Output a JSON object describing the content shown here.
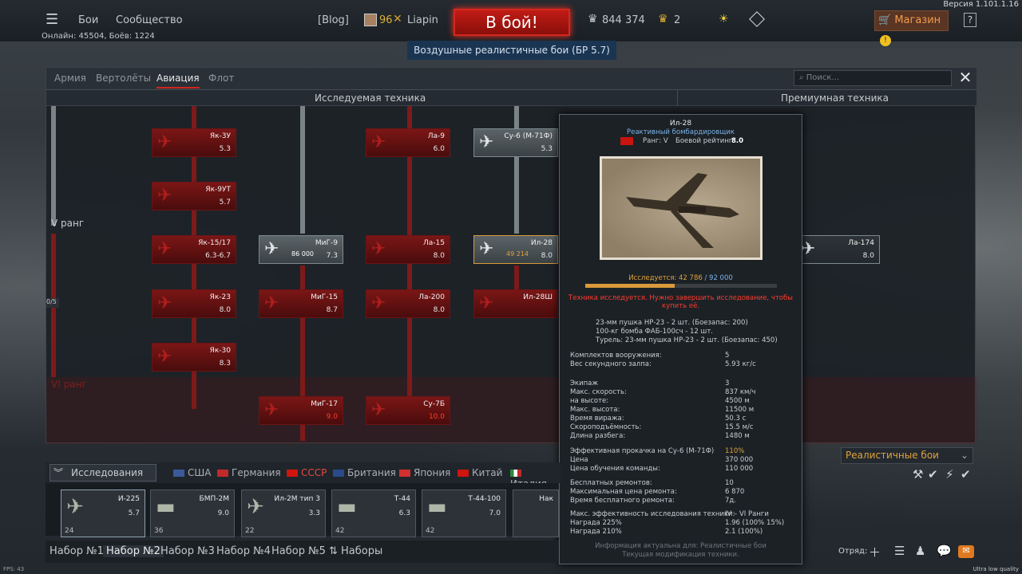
{
  "topbar": {
    "battles": "Бои",
    "community": "Сообщество",
    "blog": "[Blog]",
    "player_level": "96",
    "player_name": "Liapin",
    "battle_button": "В бой!",
    "silver_lions": "844 374",
    "golden_eagles": "2",
    "shop": "Магазин",
    "help": "?",
    "version": "Версия 1.101.1.16",
    "online": "Онлайн: 45504, Боёв: 1224",
    "mode_banner": "Воздушные реалистичные бои (БР 5.7)"
  },
  "window": {
    "tabs": [
      "Армия",
      "Вертолёты",
      "Авиация",
      "Флот"
    ],
    "active_tab": "Авиация",
    "search_placeholder": "Поиск...",
    "col_research": "Исследуемая техника",
    "col_premium": "Премиумная техника",
    "rank5": "V ранг",
    "rank6": "VI ранг",
    "progress_counter": "0/5"
  },
  "tree": {
    "yak3u": {
      "name": "Як-3У",
      "br": "5.3"
    },
    "yak9ut": {
      "name": "Як-9УТ",
      "br": "5.7"
    },
    "yak15": {
      "name": "Як-15/17",
      "br": "6.3-6.7"
    },
    "yak23": {
      "name": "Як-23",
      "br": "8.0"
    },
    "yak30": {
      "name": "Як-30",
      "br": "8.3"
    },
    "mig9": {
      "name": "МиГ-9",
      "br": "7.3",
      "cost": "86 000"
    },
    "mig15": {
      "name": "МиГ-15",
      "br": "8.7"
    },
    "mig17": {
      "name": "МиГ-17",
      "br": "9.0"
    },
    "la9": {
      "name": "Ла-9",
      "br": "6.0"
    },
    "la15": {
      "name": "Ла-15",
      "br": "8.0"
    },
    "la200": {
      "name": "Ла-200",
      "br": "8.0"
    },
    "su7b": {
      "name": "Су-7Б",
      "br": "10.0"
    },
    "su6": {
      "name": "Су-6 (М-71Ф)",
      "br": "5.3"
    },
    "il28": {
      "name": "Ил-28",
      "br": "8.0",
      "cost": "49 214"
    },
    "il28sh": {
      "name": "Ил-28Ш",
      "br": ""
    },
    "la174": {
      "name": "Ла-174",
      "br": "8.0"
    }
  },
  "tooltip": {
    "name": "Ил-28",
    "class": "Реактивный бомбардировщик",
    "rank": "Ранг: V",
    "br_label": "Боевой рейтинг:",
    "br": "8.0",
    "research_label": "Исследуется:",
    "research_progress": "42 786",
    "research_total": "/ 92 000",
    "research_fraction": 0.465,
    "warning": "Техника исследуется. Нужно завершить исследование, чтобы купить её.",
    "weapons": [
      "23-мм пушка НР-23 - 2 шт. (Боезапас: 200)",
      "100-кг бомба ФАБ-100сч - 12 шт.",
      "Турель: 23-мм пушка НР-23 - 2 шт. (Боезапас: 450)"
    ],
    "stats": [
      {
        "k": "Комплектов вооружения:",
        "v": "5"
      },
      {
        "k": "Вес секундного залпа:",
        "v": "5.93 кг/с"
      },
      {
        "k": "Экипаж",
        "v": "3"
      },
      {
        "k": "Макс. скорость:",
        "v": "837 км/ч"
      },
      {
        "k": "на высоте:",
        "v": "4500 м"
      },
      {
        "k": "Макс. высота:",
        "v": "11500 м"
      },
      {
        "k": "Время виража:",
        "v": "50.3 с"
      },
      {
        "k": "Скороподъёмность:",
        "v": "15.5 м/с"
      },
      {
        "k": "Длина разбега:",
        "v": "1480 м"
      },
      {
        "k": "Эффективная прокачка на Су-6 (М-71Ф)",
        "v": "110%"
      },
      {
        "k": "Цена",
        "v": "370 000"
      },
      {
        "k": "Цена обучения команды:",
        "v": "110 000"
      },
      {
        "k": "Бесплатных ремонтов:",
        "v": "10"
      },
      {
        "k": "Максимальная цена ремонта:",
        "v": "6 870"
      },
      {
        "k": "Время бесплатного ремонта:",
        "v": "7д."
      },
      {
        "k": "Макс. эффективность исследования техники:",
        "v": "IV – VI Ранги"
      },
      {
        "k": "Награда 225%",
        "v": "1.96 (100% 15%)"
      },
      {
        "k": "Награда 210%",
        "v": "2.1 (100%)"
      }
    ],
    "footer1": "Информация актуальна для: Реалистичные бои",
    "footer2": "Текущая модификация техники."
  },
  "bottom": {
    "research_tab": "Исследования",
    "nations": [
      "США",
      "Германия",
      "СССР",
      "Британия",
      "Япония",
      "Китай",
      "Италия"
    ],
    "active_nation": "СССР",
    "slots": [
      {
        "name": "И-225",
        "br": "5.7",
        "crew": "24"
      },
      {
        "name": "БМП-2М",
        "br": "9.0",
        "crew": "36"
      },
      {
        "name": "Ил-2М тип 3",
        "br": "3.3",
        "crew": "22"
      },
      {
        "name": "Т-44",
        "br": "6.3",
        "crew": "42"
      },
      {
        "name": "Т-44-100",
        "br": "7.0",
        "crew": "42"
      },
      {
        "name": "Нак",
        "br": "",
        "crew": ""
      }
    ],
    "presets": [
      "Набор №1",
      "Набор №2",
      "Набор №3",
      "Набор №4",
      "Набор №5",
      "Наборы"
    ],
    "active_preset": "Набор №2",
    "mode_select": "Реалистичные бои",
    "squad": "Отряд:",
    "fps": "FPS: 43",
    "quality": "Ultra low quality"
  },
  "colors": {
    "accent": "#d0261c",
    "research": "#e0a23a",
    "premium_blue": "#7ab3e8"
  }
}
